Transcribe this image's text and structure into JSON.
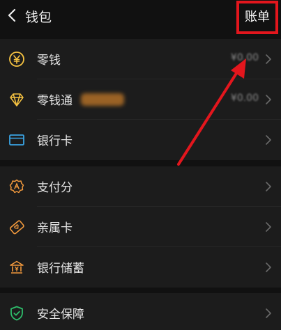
{
  "header": {
    "title": "钱包",
    "bill_label": "账单"
  },
  "sections": [
    {
      "items": [
        {
          "label": "零钱",
          "value": "¥0.00",
          "icon": "yuan-coin-icon"
        },
        {
          "label": "零钱通",
          "value": "¥0.00",
          "icon": "diamond-icon"
        },
        {
          "label": "银行卡",
          "icon": "bank-card-icon"
        }
      ]
    },
    {
      "items": [
        {
          "label": "支付分",
          "icon": "pay-score-shield-icon"
        },
        {
          "label": "亲属卡",
          "icon": "family-card-icon"
        },
        {
          "label": "银行储蓄",
          "icon": "bank-building-icon"
        }
      ]
    },
    {
      "items": [
        {
          "label": "安全保障",
          "icon": "security-shield-icon"
        }
      ]
    }
  ],
  "colors": {
    "background": "#111111",
    "row_background": "#1c1c1c",
    "accent_yellow": "#f5c241",
    "accent_blue": "#3aa3e3",
    "accent_orange": "#f39a3d",
    "accent_green": "#2ebd6b",
    "annotation_red": "#e3161d"
  }
}
